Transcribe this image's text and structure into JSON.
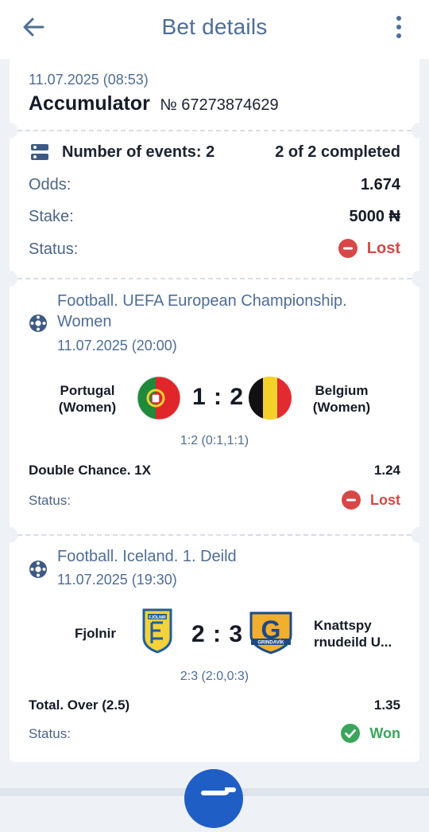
{
  "header": {
    "title": "Bet details"
  },
  "bet": {
    "datetime": "11.07.2025 (08:53)",
    "type": "Accumulator",
    "number": "№ 67273874629"
  },
  "summary": {
    "events_label": "Number of events: 2",
    "completed": "2 of 2 completed",
    "odds_label": "Odds:",
    "odds_value": "1.674",
    "stake_label": "Stake:",
    "stake_value": "5000 ₦",
    "status_label": "Status:",
    "status_value": "Lost"
  },
  "events": [
    {
      "title_line1": "Football. UEFA European Championship.",
      "title_line2": "Women",
      "datetime": "11.07.2025 (20:00)",
      "home_line1": "Portugal",
      "home_line2": "(Women)",
      "away_line1": "Belgium",
      "away_line2": "(Women)",
      "score": "1 : 2",
      "score_detail": "1:2 (0:1,1:1)",
      "market": "Double Chance. 1X",
      "odds": "1.24",
      "status_label": "Status:",
      "status": "Lost"
    },
    {
      "title": "Football. Iceland. 1. Deild",
      "datetime": "11.07.2025 (19:30)",
      "home": "Fjolnir",
      "away_line1": "Knattspy",
      "away_line2": "rnudeild U...",
      "score": "2 : 3",
      "score_detail": "2:3 (2:0,0:3)",
      "market": "Total. Over (2.5)",
      "odds": "1.35",
      "status_label": "Status:",
      "status": "Won",
      "home_logo_text": "FJÖLNIR",
      "away_logo_text": "GRINDAVÍK"
    }
  ],
  "colors": {
    "accent": "#4d6e96",
    "lost": "#d84747",
    "won": "#3aa55b",
    "fab": "#1f5fc5"
  },
  "icons": {
    "back": "arrow-left-icon",
    "menu": "more-vertical-icon",
    "events": "list-toggle-icon",
    "sport": "football-icon",
    "lost": "minus-circle-icon",
    "won": "check-circle-icon"
  }
}
